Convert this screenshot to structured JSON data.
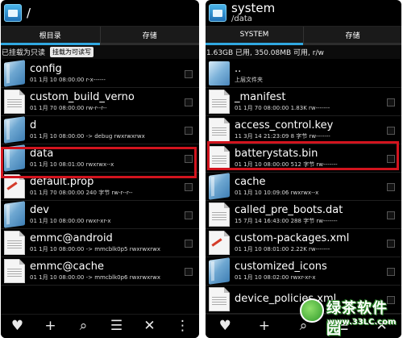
{
  "left_panel": {
    "title": "/",
    "tabs": [
      {
        "label": "根目录",
        "active": true
      },
      {
        "label": "存储",
        "active": false
      }
    ],
    "info_text": "已挂载为只读",
    "remount_button": "挂载为可读写",
    "items": [
      {
        "name": "config",
        "info": "01 1月 10 08:00:00   r-x------",
        "kind": "folder",
        "highlighted": false
      },
      {
        "name": "custom_build_verno",
        "info": "01 1月 70 08:00:00   rw-r--r--",
        "kind": "file",
        "highlighted": false
      },
      {
        "name": "d",
        "info": "01 1月 10 08:00:00 -> debug rwxrwxrwx",
        "kind": "folder",
        "highlighted": false
      },
      {
        "name": "data",
        "info": "01 1月 10 08:01:00   rwxrwx--x",
        "kind": "folder",
        "highlighted": true
      },
      {
        "name": "default.prop",
        "info": "01 1月 70 08:00:00 240 字节  rw-r--r--",
        "kind": "file-red",
        "highlighted": false
      },
      {
        "name": "dev",
        "info": "01 1月 10 08:00:00   rwxr-xr-x",
        "kind": "folder",
        "highlighted": false
      },
      {
        "name": "emmc@android",
        "info": "01 1月 10 08:00:00 -> mmcblk0p5 rwxrwxrwx",
        "kind": "file",
        "highlighted": false
      },
      {
        "name": "emmc@cache",
        "info": "01 1月 10 08:00:00 -> mmcblk0p6 rwxrwxrwx",
        "kind": "file",
        "highlighted": false
      }
    ]
  },
  "right_panel": {
    "title": "system",
    "subtitle": "/data",
    "tabs": [
      {
        "label": "SYSTEM",
        "active": true
      },
      {
        "label": "存储",
        "active": false
      }
    ],
    "info_text": "1.63GB 已用, 350.08MB 可用, r/w",
    "items": [
      {
        "name": "..",
        "info": "上层文件夹",
        "kind": "up",
        "highlighted": false
      },
      {
        "name": "_manifest",
        "info": "01 1月 70 08:00:00 1.83K rw-------",
        "kind": "file",
        "highlighted": false
      },
      {
        "name": "access_control.key",
        "info": "11 3月 14 21:23:09 8 字节  rw-------",
        "kind": "file",
        "highlighted": false
      },
      {
        "name": "batterystats.bin",
        "info": "01 1月 10 08:00:00 512 字节  rw-------",
        "kind": "file",
        "highlighted": true
      },
      {
        "name": "cache",
        "info": "01 1月 10 10:09:06   rwxrwx--x",
        "kind": "folder",
        "highlighted": false
      },
      {
        "name": "called_pre_boots.dat",
        "info": "15 7月 14 16:43:00 288 字节  rw-------",
        "kind": "file",
        "highlighted": false
      },
      {
        "name": "custom-packages.xml",
        "info": "01 1月 10 08:01:00 2.22K rw-------",
        "kind": "file-red",
        "highlighted": false
      },
      {
        "name": "customized_icons",
        "info": "01 1月 10 08:02:00   rwxr-xr-x",
        "kind": "folder",
        "highlighted": false
      },
      {
        "name": "device_policies.xml",
        "info": "",
        "kind": "file",
        "highlighted": false
      }
    ]
  },
  "bottom_bar": {
    "icons": [
      "heart-icon",
      "plus-icon",
      "search-icon",
      "sort-icon",
      "close-icon",
      "more-icon"
    ]
  },
  "watermark": {
    "title": "绿茶软件园",
    "url": "www.33LC.com"
  },
  "colors": {
    "accent": "#31a8e0",
    "highlight": "#d2141e",
    "background": "#000000"
  }
}
